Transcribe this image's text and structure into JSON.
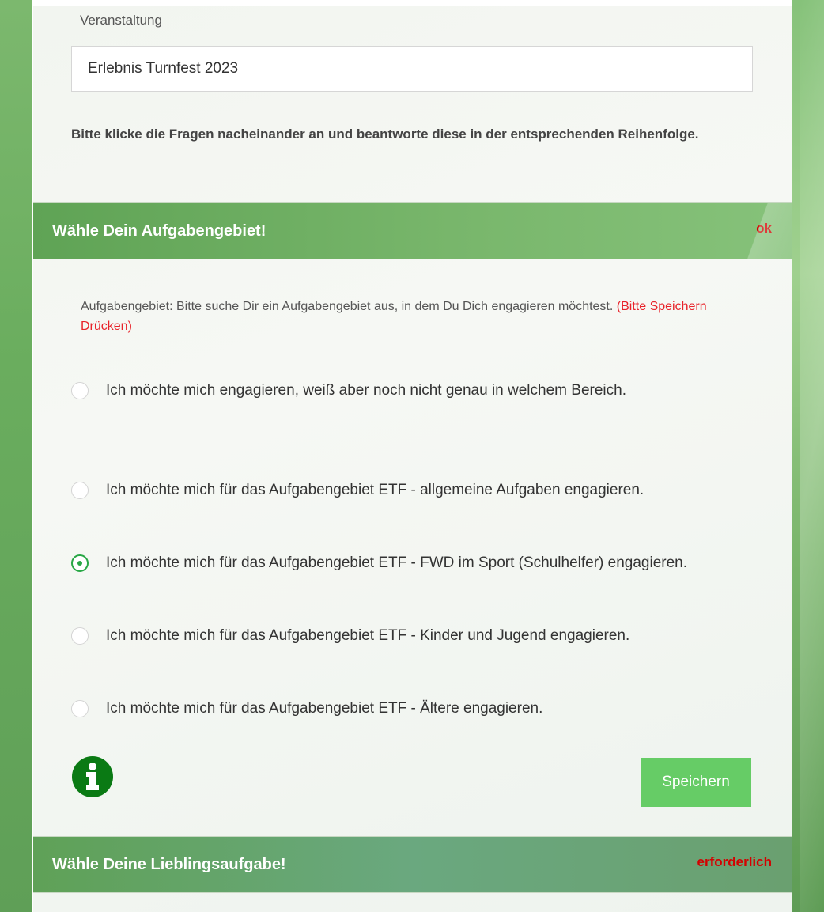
{
  "event_field": {
    "label": "Veranstaltung",
    "value": "Erlebnis Turnfest 2023"
  },
  "instructions": "Bitte klicke die Fragen nacheinander an und beantworte diese in der entsprechenden Reihenfolge.",
  "sections": [
    {
      "title": "Wähle Dein Aufgabengebiet!",
      "status": "ok",
      "description": "Aufgabengebiet: Bitte suche Dir ein Aufgabengebiet aus, in dem Du Dich engagieren möchtest.",
      "hint": "(Bitte Speichern Drücken)",
      "options": [
        {
          "label": "Ich möchte mich engagieren, weiß aber noch nicht genau in welchem Bereich.",
          "selected": false
        },
        {
          "label": "Ich möchte mich für das Aufgabengebiet ETF - allgemeine Aufgaben engagieren.",
          "selected": false
        },
        {
          "label": "Ich möchte mich für das Aufgabengebiet ETF - FWD im Sport (Schulhelfer) engagieren.",
          "selected": true
        },
        {
          "label": "Ich möchte mich für das Aufgabengebiet ETF - Kinder und Jugend engagieren.",
          "selected": false
        },
        {
          "label": "Ich möchte mich für das Aufgabengebiet ETF - Ältere engagieren.",
          "selected": false
        }
      ],
      "save_label": "Speichern",
      "info_icon": "info-circle-icon"
    },
    {
      "title": "Wähle Deine Lieblingsaufgabe!",
      "status": "erforderlich"
    }
  ],
  "colors": {
    "accent_green": "#66cc66",
    "radio_checked": "#28a745",
    "status_red": "#d40000",
    "hint_red": "#e8232a",
    "info_icon": "#0a7a14"
  }
}
